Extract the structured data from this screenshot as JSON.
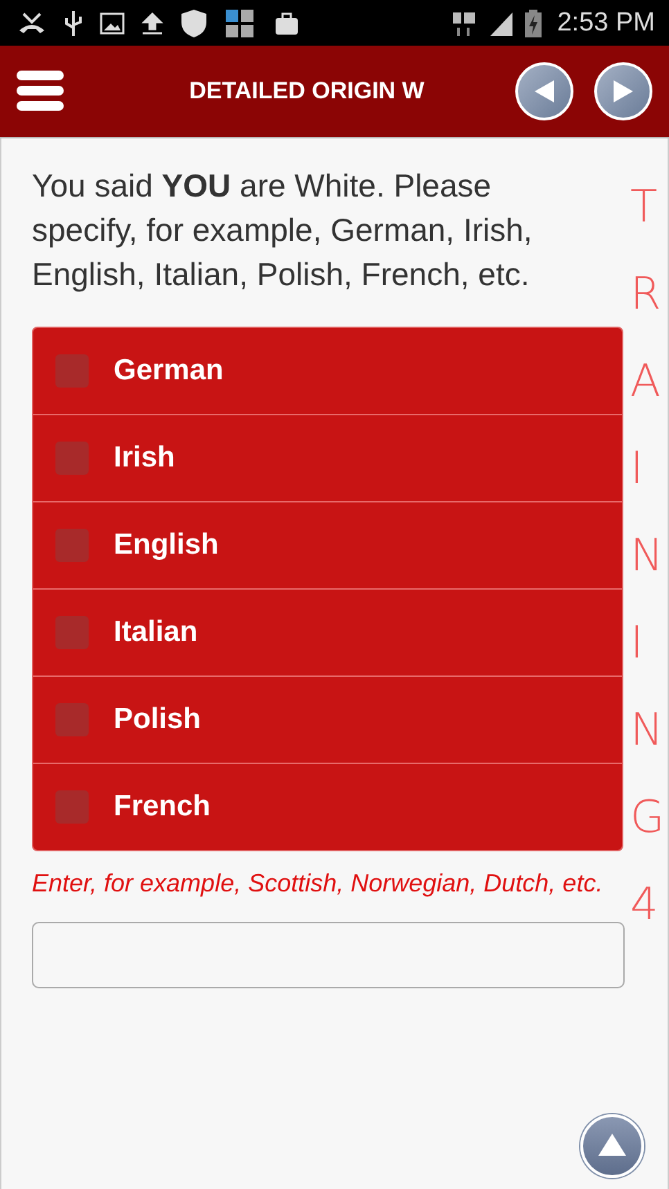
{
  "status_bar": {
    "time": "2:53 PM"
  },
  "header": {
    "title": "DETAILED ORIGIN W"
  },
  "question": "You said **YOU** are White. Please specify, for example, German, Irish, English, Italian, Polish, French, etc.",
  "overlay": {
    "text": "TRAINING4"
  },
  "options": [
    {
      "label": "German",
      "checked": false
    },
    {
      "label": "Irish",
      "checked": false
    },
    {
      "label": "English",
      "checked": false
    },
    {
      "label": "Italian",
      "checked": false
    },
    {
      "label": "Polish",
      "checked": false
    },
    {
      "label": "French",
      "checked": false
    }
  ],
  "other": {
    "hint": "Enter, for example, Scottish, Norwegian, Dutch, etc."
  }
}
